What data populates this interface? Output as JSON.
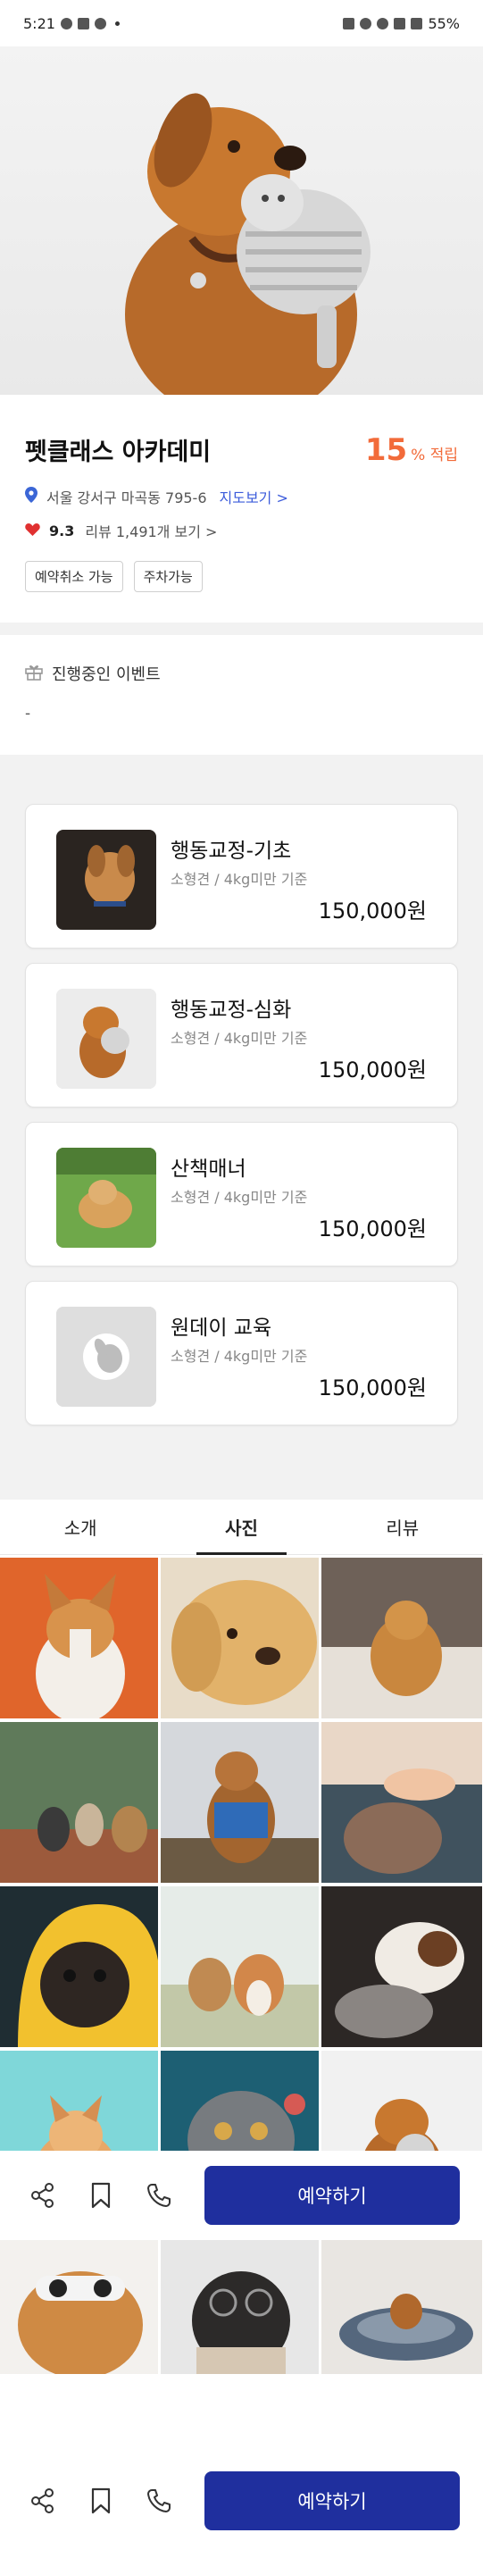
{
  "status_bar": {
    "time": "5:21",
    "battery": "55%"
  },
  "academy": {
    "name": "펫클래스 아카데미",
    "points_value": "15",
    "points_label": "% 적립",
    "address": "서울 강서구 마곡동 795-6",
    "map_link": "지도보기 >",
    "rating": "9.3",
    "reviews": "리뷰 1,491개 보기 >",
    "tags": [
      "예약취소 가능",
      "주차가능"
    ]
  },
  "events": {
    "title": "진행중인 이벤트",
    "value": "-"
  },
  "courses": [
    {
      "name": "행동교정-기초",
      "sub": "소형견 / 4kg미만 기준",
      "price": "150,000원"
    },
    {
      "name": "행동교정-심화",
      "sub": "소형견 / 4kg미만 기준",
      "price": "150,000원"
    },
    {
      "name": "산책매너",
      "sub": "소형견 / 4kg미만 기준",
      "price": "150,000원"
    },
    {
      "name": "원데이 교육",
      "sub": "소형견 / 4kg미만 기준",
      "price": "150,000원"
    }
  ],
  "tabs": [
    "소개",
    "사진",
    "리뷰"
  ],
  "active_tab": "사진",
  "action_bar": {
    "reserve_label": "예약하기"
  },
  "icons": [
    "share-icon",
    "bookmark-icon",
    "phone-icon",
    "location-pin-icon",
    "heart-icon",
    "gift-icon",
    "dog-placeholder-icon"
  ],
  "colors": {
    "accent": "#f26b3a",
    "primary": "#1f2f9e",
    "link": "#3b5bdb",
    "heart": "#e03131"
  }
}
